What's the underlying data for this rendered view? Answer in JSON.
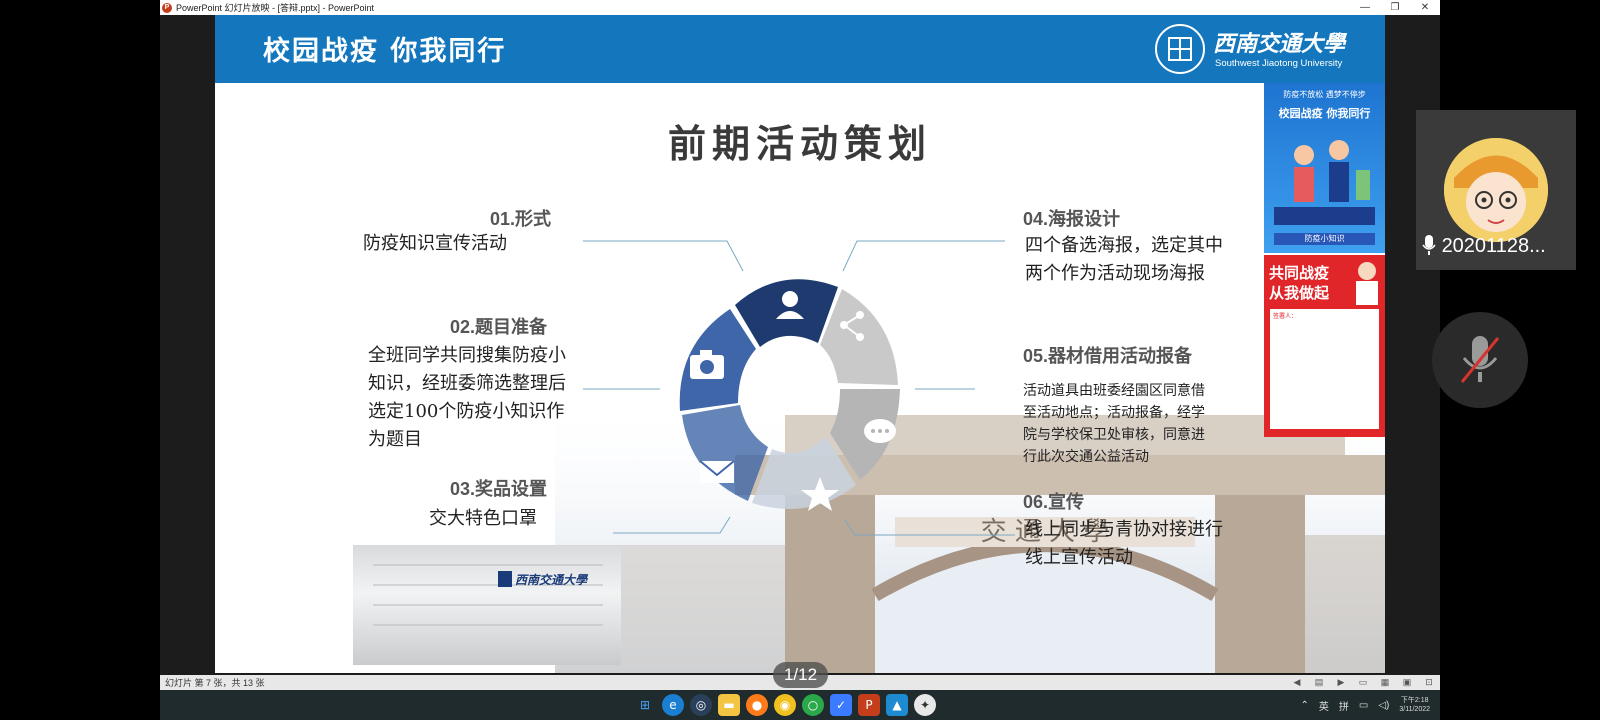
{
  "window": {
    "title": "PowerPoint 幻灯片放映 - [答辩.pptx] - PowerPoint",
    "minimize": "—",
    "maximize": "❐",
    "close": "✕"
  },
  "slide": {
    "header_title": "校园战疫 你我同行",
    "university_cn": "西南交通大學",
    "university_en": "Southwest Jiaotong University",
    "title": "前期活动策划",
    "items": [
      {
        "heading": "01.形式",
        "body": "防疫知识宣传活动"
      },
      {
        "heading": "02.题目准备",
        "body": "全班同学共同搜集防疫小知识，经班委筛选整理后选定100个防疫小知识作为题目"
      },
      {
        "heading": "03.奖品设置",
        "body": "交大特色口罩"
      },
      {
        "heading": "04.海报设计",
        "body": "四个备选海报，选定其中两个作为活动现场海报"
      },
      {
        "heading": "05.器材借用活动报备",
        "body": "活动道具由班委经園区同意借至活动地点；活动报备，经学院与学校保卫处审核，同意进行此次交通公益活动"
      },
      {
        "heading": "06.宣传",
        "body": "线上同步与青协对接进行线上宣传活动"
      }
    ],
    "mask_logo": "西南交通大學",
    "gate_text": "交 通 大 學",
    "poster1": {
      "top": "防疫不放松 遇梦不停步",
      "title": "校园战疫 你我同行",
      "bottom": "防疫小知识"
    },
    "poster2": {
      "title_line1": "共同战疫",
      "title_line2": "从我做起",
      "label": "签署人："
    }
  },
  "status_bar": {
    "text": "幻灯片 第 7 张，共 13 张"
  },
  "page_indicator": "1/12",
  "taskbar": {
    "tray_lang1": "英",
    "tray_lang2": "拼",
    "time": "下午2:18",
    "date": "3/11/2022"
  },
  "video": {
    "participant_name": "20201128..."
  },
  "colors": {
    "header_blue": "#1477bd",
    "ring_dark_navy": "#1e3a6e",
    "ring_blue": "#3f66a8",
    "ring_gray": "#c7c7c7",
    "poster_red": "#e1262a"
  }
}
